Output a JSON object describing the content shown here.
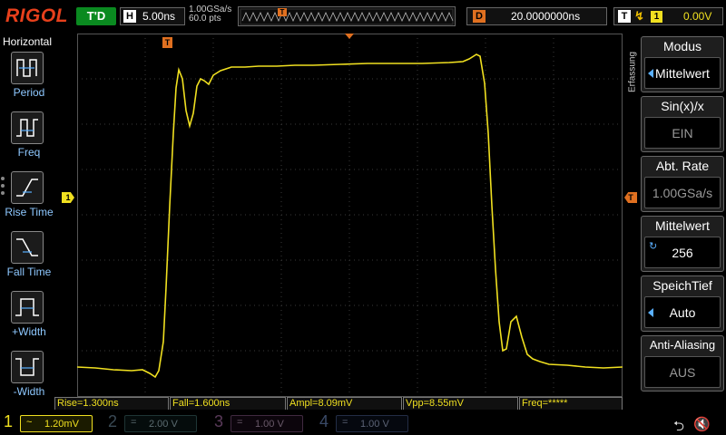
{
  "header": {
    "brand": "RIGOL",
    "run_state": "T'D",
    "horizontal": {
      "letter": "H",
      "timebase": "5.00ns"
    },
    "sampling": {
      "rate": "1.00GSa/s",
      "points": "60.0 pts"
    },
    "delay": {
      "letter": "D",
      "value": "20.0000000ns"
    },
    "trigger": {
      "letter": "T",
      "edge_icon": "rising-edge-icon",
      "source": "1",
      "level": "0.00V"
    }
  },
  "left_menu": {
    "title": "Horizontal",
    "items": [
      {
        "label": "Period",
        "icon": "period-icon"
      },
      {
        "label": "Freq",
        "icon": "frequency-icon"
      },
      {
        "label": "Rise Time",
        "icon": "rise-time-icon"
      },
      {
        "label": "Fall Time",
        "icon": "fall-time-icon"
      },
      {
        "label": "+Width",
        "icon": "positive-width-icon"
      },
      {
        "label": "-Width",
        "icon": "negative-width-icon"
      }
    ]
  },
  "grid": {
    "markers": {
      "trigger_position": "T",
      "channel_ref": "1",
      "trigger_level": "T"
    }
  },
  "right_menu": {
    "section_label": "Erfassung",
    "items": [
      {
        "title": "Modus",
        "value": "Mittelwert",
        "selectable": true
      },
      {
        "title": "Sin(x)/x",
        "value": "EIN",
        "selectable": false
      },
      {
        "title": "Abt. Rate",
        "value": "1.00GSa/s",
        "selectable": false
      },
      {
        "title": "Mittelwert",
        "value": "256",
        "knob": true
      },
      {
        "title": "SpeichTief",
        "value": "Auto",
        "selectable": true
      },
      {
        "title": "Anti-Aliasing",
        "value": "AUS",
        "selectable": false
      }
    ]
  },
  "measurements": {
    "rise": "Rise=1.300ns",
    "fall": "Fall=1.600ns",
    "ampl": "Ampl=8.09mV",
    "vpp": "Vpp=8.55mV",
    "freq": "Freq=*****"
  },
  "channels": [
    {
      "num": "1",
      "coupling": "~",
      "scale": "1.20mV",
      "active": true,
      "color": "#f0e020"
    },
    {
      "num": "2",
      "coupling": "=",
      "scale": "2.00 V",
      "active": false,
      "color": "#1f3535"
    },
    {
      "num": "3",
      "coupling": "=",
      "scale": "1.00 V",
      "active": false,
      "color": "#402a40"
    },
    {
      "num": "4",
      "coupling": "=",
      "scale": "1.00 V",
      "active": false,
      "color": "#232d46"
    }
  ],
  "status_icons": {
    "usb": "usb-icon",
    "speaker": "speaker-muted-icon"
  },
  "colors": {
    "brand": "#e8401c",
    "ch1": "#f0e020",
    "trigger": "#e07020",
    "run": "#0a8a20",
    "menu_label": "#8ec8ff"
  }
}
